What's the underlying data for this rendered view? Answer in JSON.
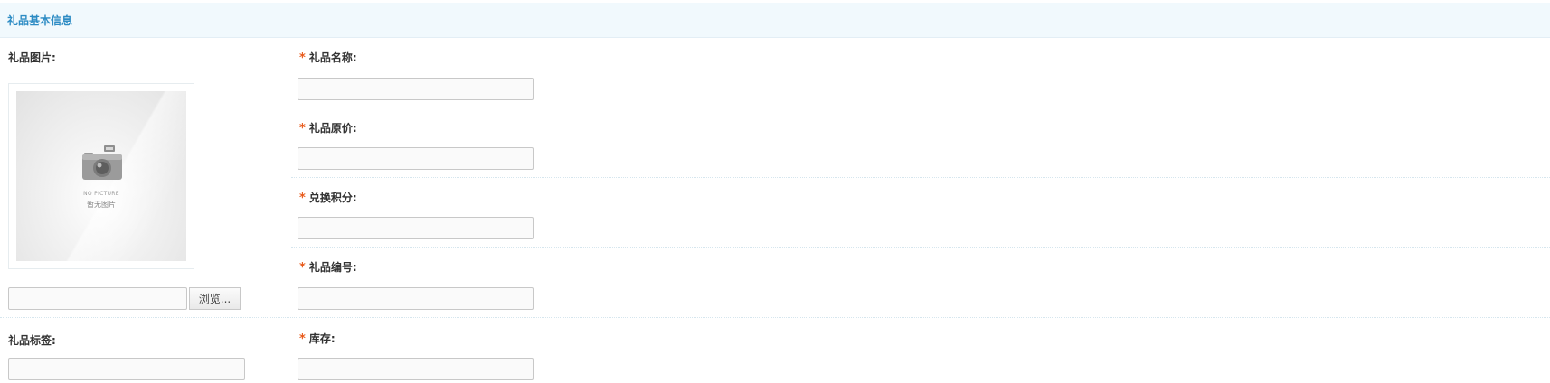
{
  "section": {
    "title": "礼品基本信息"
  },
  "image_field": {
    "label": "礼品图片:",
    "placeholder_en": "NO PICTURE",
    "placeholder_cn": "暂无图片",
    "file_value": "",
    "browse_label": "浏览..."
  },
  "tag_field": {
    "label": "礼品标签:",
    "value": ""
  },
  "fields": [
    {
      "label": "礼品名称:",
      "required": "*",
      "value": ""
    },
    {
      "label": "礼品原价:",
      "required": "*",
      "value": ""
    },
    {
      "label": "兑换积分:",
      "required": "*",
      "value": ""
    },
    {
      "label": "礼品编号:",
      "required": "*",
      "value": ""
    },
    {
      "label": "库存:",
      "required": "*",
      "value": ""
    }
  ],
  "colors": {
    "accent": "#2e8cc4",
    "required": "#e8591a",
    "header_bg": "#f1f9fd"
  }
}
